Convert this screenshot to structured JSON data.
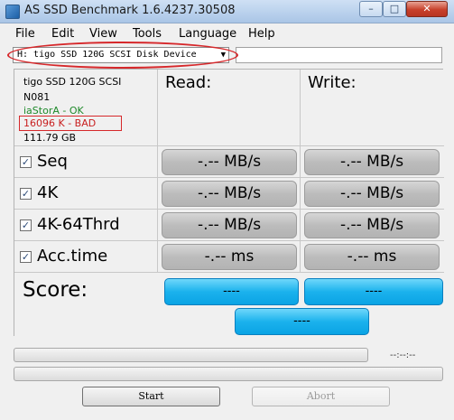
{
  "window": {
    "title": "AS SSD Benchmark 1.6.4237.30508"
  },
  "menu": [
    "File",
    "Edit",
    "View",
    "Tools",
    "Language",
    "Help"
  ],
  "drive": {
    "selected": "H: tigo SSD 120G SCSI Disk Device",
    "arrow": "▼"
  },
  "info": {
    "model": "tigo SSD 120G SCSI",
    "firmware": "N081",
    "driver": "iaStorA - OK",
    "alignment": "16096 K - BAD",
    "capacity": "111.79 GB"
  },
  "headers": {
    "read": "Read:",
    "write": "Write:"
  },
  "rows": [
    {
      "label": "Seq",
      "read": "-.-- MB/s",
      "write": "-.-- MB/s"
    },
    {
      "label": "4K",
      "read": "-.-- MB/s",
      "write": "-.-- MB/s"
    },
    {
      "label": "4K-64Thrd",
      "read": "-.-- MB/s",
      "write": "-.-- MB/s"
    },
    {
      "label": "Acc.time",
      "read": "-.-- ms",
      "write": "-.-- ms"
    }
  ],
  "score": {
    "label": "Score:",
    "read": "----",
    "write": "----",
    "total": "----"
  },
  "progress": {
    "time": "--:--:--"
  },
  "buttons": {
    "start": "Start",
    "abort": "Abort"
  },
  "colors": {
    "ok": "#1f8a2b",
    "bad": "#c81e1e",
    "score": "#1bb2ed",
    "highlight": "#d6282b"
  }
}
